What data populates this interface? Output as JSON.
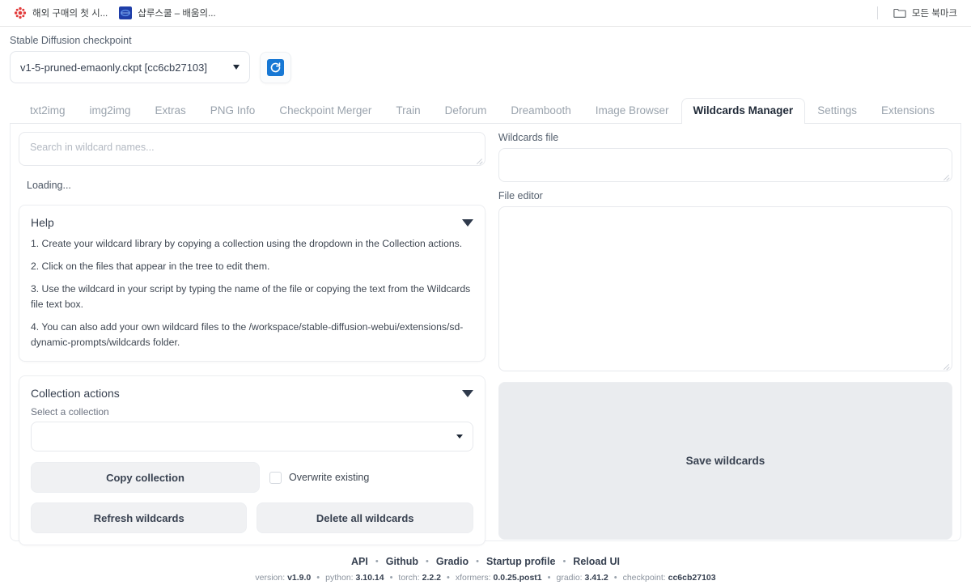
{
  "browser": {
    "bookmarks": [
      {
        "title": "해외 구매의 첫 시...",
        "favicon": "red-flower-icon"
      },
      {
        "title": "샵루스쿨 – 배움의...",
        "favicon": "blue-square-icon"
      }
    ],
    "all_bookmarks_label": "모든 북마크",
    "all_bookmarks_icon": "folder-icon"
  },
  "checkpoint": {
    "label": "Stable Diffusion checkpoint",
    "value": "v1-5-pruned-emaonly.ckpt [cc6cb27103]",
    "caret_icon": "chevron-down-icon",
    "refresh_icon": "refresh-icon"
  },
  "tabs": [
    {
      "label": "txt2img",
      "active": false
    },
    {
      "label": "img2img",
      "active": false
    },
    {
      "label": "Extras",
      "active": false
    },
    {
      "label": "PNG Info",
      "active": false
    },
    {
      "label": "Checkpoint Merger",
      "active": false
    },
    {
      "label": "Train",
      "active": false
    },
    {
      "label": "Deforum",
      "active": false
    },
    {
      "label": "Dreambooth",
      "active": false
    },
    {
      "label": "Image Browser",
      "active": false
    },
    {
      "label": "Wildcards Manager",
      "active": true
    },
    {
      "label": "Settings",
      "active": false
    },
    {
      "label": "Extensions",
      "active": false
    }
  ],
  "left": {
    "search": {
      "placeholder": "Search in wildcard names...",
      "value": ""
    },
    "loading": "Loading...",
    "help": {
      "title": "Help",
      "toggle_icon": "triangle-down-icon",
      "items": [
        "1. Create your wildcard library by copying a collection using the dropdown in the Collection actions.",
        "2. Click on the files that appear in the tree to edit them.",
        "3. Use the wildcard in your script by typing the name of the file or copying the text from the Wildcards file text box.",
        "4. You can also add your own wildcard files to the /workspace/stable-diffusion-webui/extensions/sd-dynamic-prompts/wildcards folder."
      ]
    },
    "collection": {
      "title": "Collection actions",
      "toggle_icon": "triangle-down-icon",
      "select_label": "Select a collection",
      "select_value": "",
      "caret_icon": "chevron-down-icon",
      "copy_button": "Copy collection",
      "overwrite_label": "Overwrite existing",
      "overwrite_checked": false,
      "refresh_button": "Refresh wildcards",
      "delete_button": "Delete all wildcards"
    }
  },
  "right": {
    "wildcards_file": {
      "label": "Wildcards file",
      "value": ""
    },
    "file_editor": {
      "label": "File editor",
      "value": ""
    },
    "save_button": "Save wildcards"
  },
  "footer": {
    "links": [
      "API",
      "Github",
      "Gradio",
      "Startup profile",
      "Reload UI"
    ],
    "separator": "•",
    "version": [
      {
        "key": "version:",
        "val": "v1.9.0"
      },
      {
        "key": "python:",
        "val": "3.10.14"
      },
      {
        "key": "torch:",
        "val": "2.2.2"
      },
      {
        "key": "xformers:",
        "val": "0.0.25.post1"
      },
      {
        "key": "gradio:",
        "val": "3.41.2"
      },
      {
        "key": "checkpoint:",
        "val": "cc6cb27103"
      }
    ]
  },
  "colors": {
    "accent": "#1878d4",
    "border": "#e7e9ed",
    "text": "#374151",
    "muted": "#9aa3ad"
  }
}
